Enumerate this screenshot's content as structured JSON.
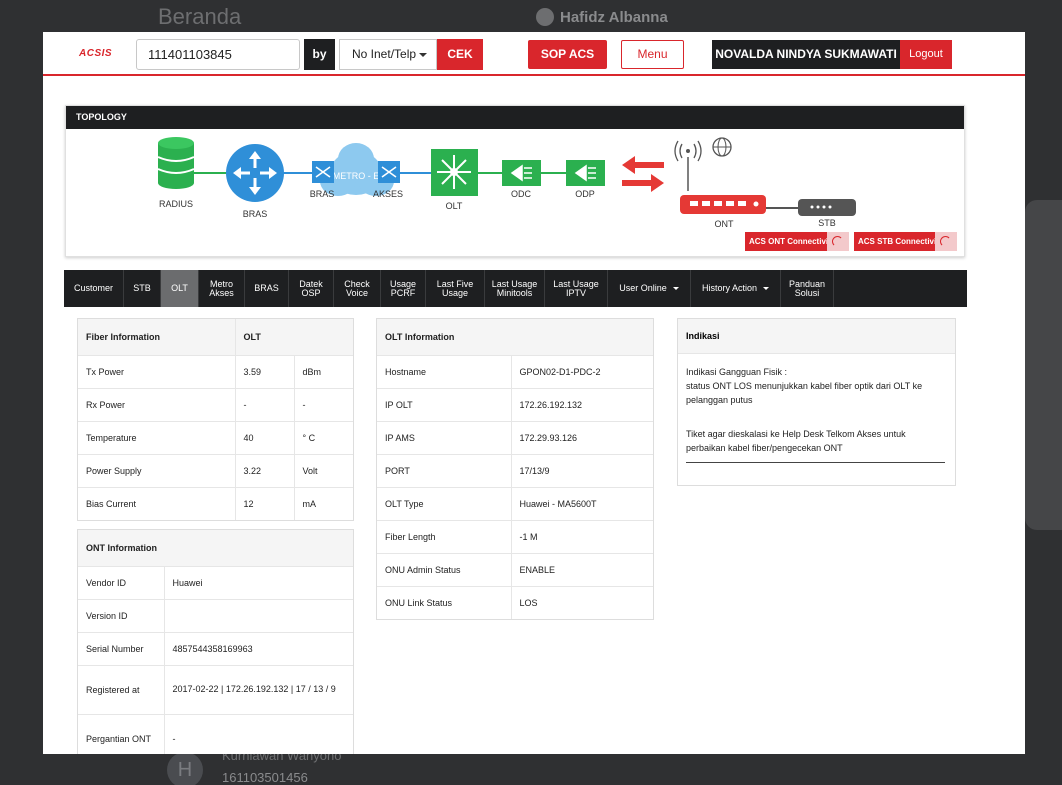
{
  "background": {
    "title": "Beranda",
    "user_name": "Hafidz Albanna",
    "row_name": "Kurniawan Wahyono",
    "row_id": "161103501456",
    "avatar_letter": "H"
  },
  "header": {
    "logo": "ACSIS",
    "search_value": "111401103845",
    "by_label": "by",
    "select_value": "No Inet/Telp",
    "cek_label": "CEK",
    "sop_label": "SOP ACS",
    "menu_label": "Menu",
    "user_name": "NOVALDA NINDYA SUKMAWATI",
    "logout_label": "Logout"
  },
  "topology": {
    "title": "TOPOLOGY",
    "nodes": {
      "radius": "RADIUS",
      "bras": "BRAS",
      "bras2": "BRAS",
      "metro": "METRO - E",
      "akses": "AKSES",
      "olt": "OLT",
      "odc": "ODC",
      "odp": "ODP",
      "ont": "ONT",
      "stb": "STB"
    },
    "acs_ont": "ACS ONT Connectivity",
    "acs_stb": "ACS STB Connectivity",
    "colors": {
      "green": "#2bb04f",
      "blue": "#2f8fd8",
      "cloud": "#8dc9ef",
      "red": "#e53935",
      "gray": "#555555"
    }
  },
  "tabs": [
    {
      "l1": "Customer",
      "l2": ""
    },
    {
      "l1": "STB",
      "l2": ""
    },
    {
      "l1": "OLT",
      "l2": ""
    },
    {
      "l1": "Metro",
      "l2": "Akses"
    },
    {
      "l1": "BRAS",
      "l2": ""
    },
    {
      "l1": "Datek",
      "l2": "OSP"
    },
    {
      "l1": "Check",
      "l2": "Voice"
    },
    {
      "l1": "Usage",
      "l2": "PCRF"
    },
    {
      "l1": "Last Five",
      "l2": "Usage"
    },
    {
      "l1": "Last Usage",
      "l2": "Minitools"
    },
    {
      "l1": "Last Usage",
      "l2": "IPTV"
    },
    {
      "l1": "User Online",
      "l2": ""
    },
    {
      "l1": "History Action",
      "l2": ""
    },
    {
      "l1": "Panduan",
      "l2": "Solusi"
    }
  ],
  "fiber": {
    "h1": "Fiber Information",
    "h2": "OLT",
    "rows": [
      {
        "label": "Tx Power",
        "value": "3.59",
        "unit": "dBm"
      },
      {
        "label": "Rx Power",
        "value": "-",
        "unit": "-"
      },
      {
        "label": "Temperature",
        "value": "40",
        "unit": "° C"
      },
      {
        "label": "Power Supply",
        "value": "3.22",
        "unit": "Volt"
      },
      {
        "label": "Bias Current",
        "value": "12",
        "unit": "mA"
      }
    ]
  },
  "ont": {
    "title": "ONT Information",
    "rows": [
      {
        "label": "Vendor ID",
        "value": "Huawei"
      },
      {
        "label": "Version ID",
        "value": ""
      },
      {
        "label": "Serial Number",
        "value": "4857544358169963"
      },
      {
        "label": "Registered at",
        "value": "2017-02-22 | 172.26.192.132 | 17 / 13 / 9"
      },
      {
        "label": "Pergantian ONT",
        "value": "-"
      }
    ]
  },
  "olt": {
    "title": "OLT Information",
    "rows": [
      {
        "label": "Hostname",
        "value": "GPON02-D1-PDC-2"
      },
      {
        "label": "IP OLT",
        "value": "172.26.192.132"
      },
      {
        "label": "IP AMS",
        "value": "172.29.93.126"
      },
      {
        "label": "PORT",
        "value": "17/13/9"
      },
      {
        "label": "OLT Type",
        "value": "Huawei - MA5600T"
      },
      {
        "label": "Fiber Length",
        "value": "-1 M"
      },
      {
        "label": "ONU Admin Status",
        "value": "ENABLE"
      },
      {
        "label": "ONU Link Status",
        "value": "LOS"
      }
    ]
  },
  "indikasi": {
    "title": "Indikasi",
    "line1": "Indikasi Gangguan Fisik :",
    "line2": "status ONT LOS menunjukkan kabel fiber optik dari OLT ke pelanggan putus",
    "line3": "Tiket agar dieskalasi ke Help Desk Telkom Akses untuk perbaikan kabel fiber/pengecekan ONT"
  }
}
